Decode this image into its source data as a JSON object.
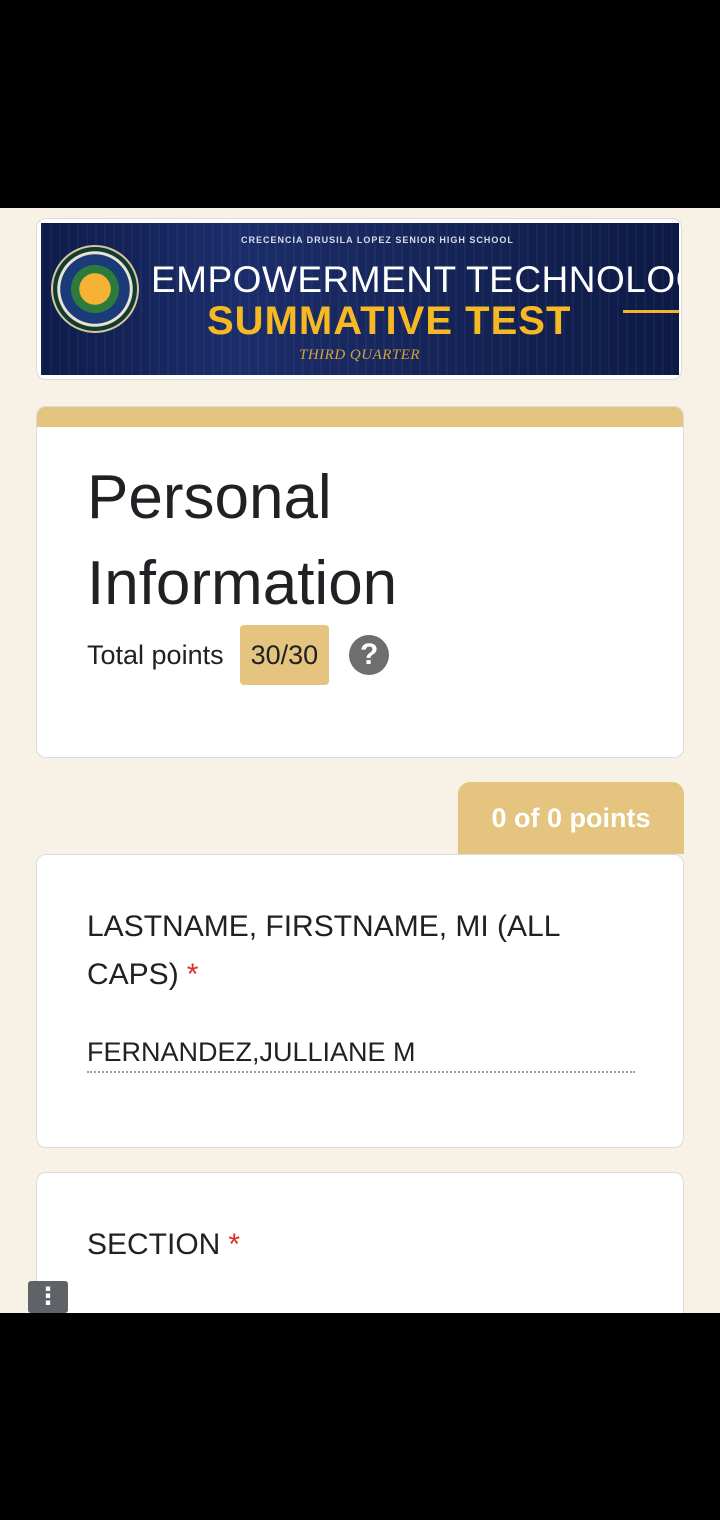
{
  "banner": {
    "school": "CRECENCIA DRUSILA LOPEZ SENIOR HIGH SCHOOL",
    "line1": "EMPOWERMENT TECHNOLOGY",
    "line2": "SUMMATIVE TEST",
    "line3": "THIRD QUARTER",
    "seal_icon": "school-seal-logo",
    "seal_text": "CRECENCIA DRUSILA LOPEZ SENIOR HIGH SCHOOL • 2016 •"
  },
  "header": {
    "title": "Personal Information",
    "points_label": "Total points",
    "points_value": "30/30",
    "help_glyph": "?",
    "help_icon": "help-icon"
  },
  "section": {
    "points_tab": "0 of 0 points"
  },
  "questions": [
    {
      "label": "LASTNAME, FIRSTNAME, MI (ALL CAPS)",
      "required_mark": "*",
      "answer": "FERNANDEZ,JULLIANE M"
    },
    {
      "label": "SECTION",
      "required_mark": "*"
    }
  ],
  "menu": {
    "glyph": "⋮",
    "icon": "more-vert-icon"
  },
  "colors": {
    "page_bg": "#f8f1e5",
    "accent": "#e4c47e",
    "required": "#d93025",
    "banner_gold": "#f6b924"
  }
}
